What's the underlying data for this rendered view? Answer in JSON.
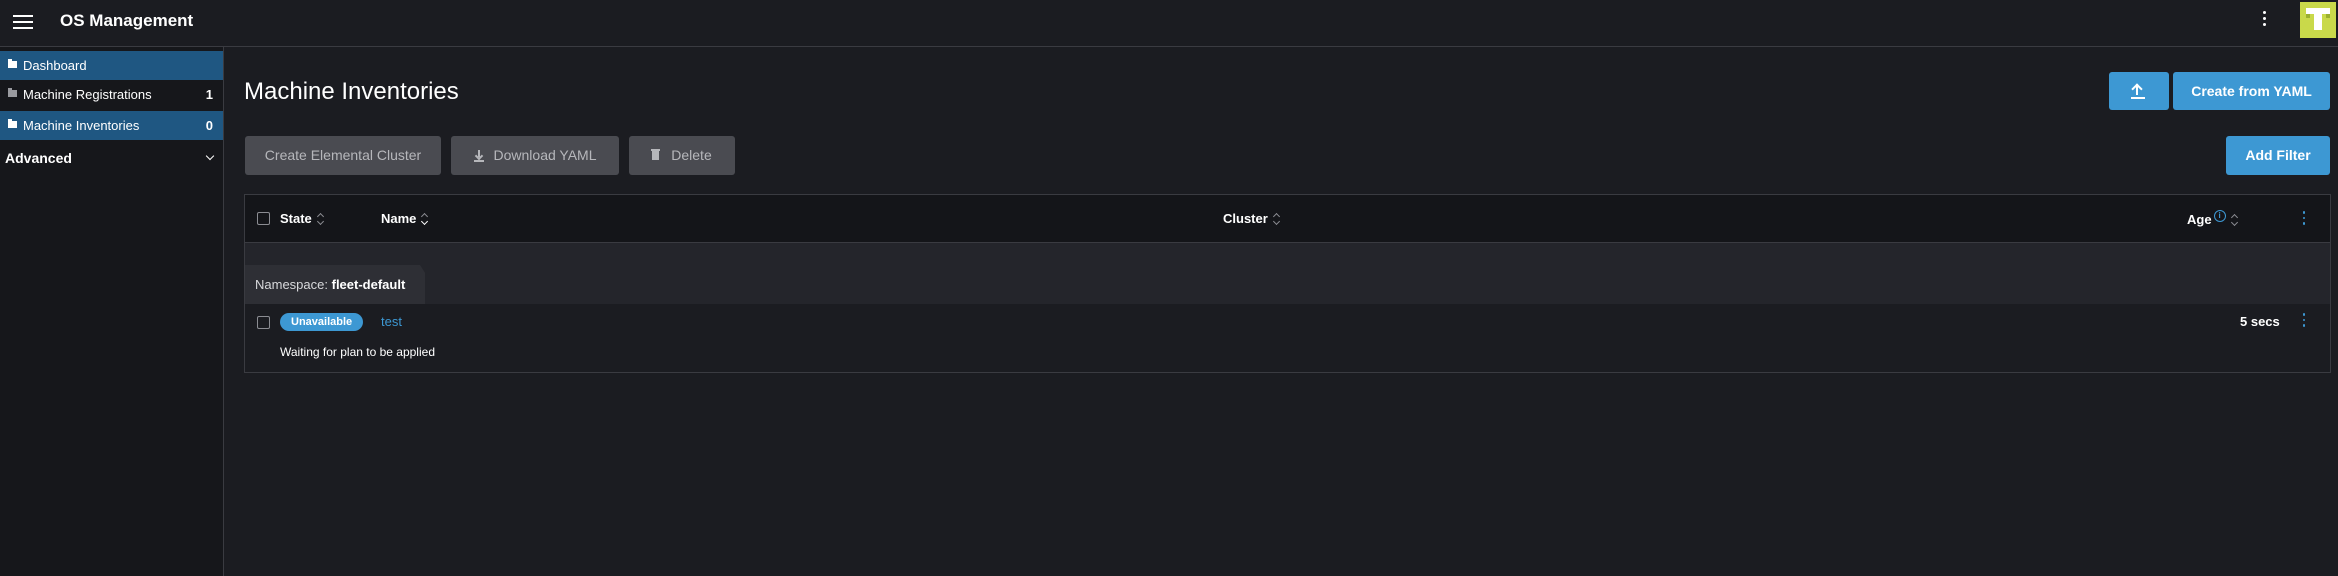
{
  "header": {
    "title": "OS Management"
  },
  "sidebar": {
    "items": [
      {
        "label": "Dashboard",
        "count": ""
      },
      {
        "label": "Machine Registrations",
        "count": "1"
      },
      {
        "label": "Machine Inventories",
        "count": "0"
      }
    ],
    "group_label": "Advanced"
  },
  "main": {
    "title": "Machine Inventories",
    "buttons": {
      "create_from_yaml": "Create from YAML",
      "create_cluster": "Create Elemental Cluster",
      "download_yaml": "Download YAML",
      "delete": "Delete",
      "add_filter": "Add Filter"
    },
    "table": {
      "columns": [
        "State",
        "Name",
        "Cluster",
        "Age"
      ],
      "namespace_prefix": "Namespace:",
      "namespace": "fleet-default",
      "rows": [
        {
          "state": "Unavailable",
          "name": "test",
          "cluster": "",
          "age": "5 secs",
          "message": "Waiting for plan to be applied"
        }
      ]
    }
  },
  "colors": {
    "accent": "#3d98d3",
    "background": "#1b1c21",
    "sidebar_active": "#1f5782",
    "avatar": "#c9d94a"
  }
}
